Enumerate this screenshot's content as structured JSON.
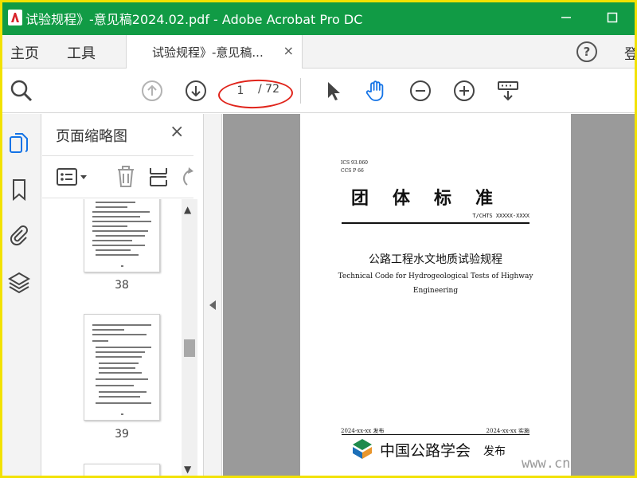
{
  "window": {
    "title": "试验规程》-意见稿2024.02.pdf - Adobe Acrobat Pro DC",
    "minimize_icon": "minimize-icon",
    "maximize_icon": "maximize-icon"
  },
  "menu": {
    "home": "主页",
    "tools": "工具",
    "doc_tab_label": "试验规程》-意见稿...",
    "doc_tab_close": "×",
    "help": "?",
    "signin": "登"
  },
  "toolbar": {
    "page_current": "1",
    "page_total": "/ 72",
    "icons": [
      "search-zoom-icon",
      "page-up-icon",
      "page-down-icon",
      "select-cursor-icon",
      "hand-tool-icon",
      "zoom-out-icon",
      "zoom-in-icon",
      "keyboard-scroll-icon"
    ]
  },
  "nav": {
    "icons": [
      "page-thumbnails-icon",
      "bookmark-icon",
      "attachment-icon",
      "layers-icon"
    ]
  },
  "panel": {
    "title": "页面缩略图",
    "close": "×",
    "thumbnails": [
      {
        "label": "38"
      },
      {
        "label": "39"
      }
    ]
  },
  "document": {
    "ics": "ICS 93.060",
    "ccs": "CCS P 66",
    "standard_title": "团体标准",
    "standard_number": "T/CHTS XXXXX-XXXX",
    "zh_title": "公路工程水文地质试验规程",
    "en_title_line1": "Technical Code  for Hydrogeological Tests of Highway",
    "en_title_line2": "Engineering",
    "publish_date": "2024-xx-xx 发布",
    "implement_date": "2024-xx-xx 实施",
    "society_name": "中国公路学会",
    "issue_label": "发布"
  },
  "watermark": "www.cn",
  "colors": {
    "titlebar": "#119b45",
    "frame": "#f2e200",
    "annotation": "#e0241b",
    "active_icon": "#1473e6"
  }
}
